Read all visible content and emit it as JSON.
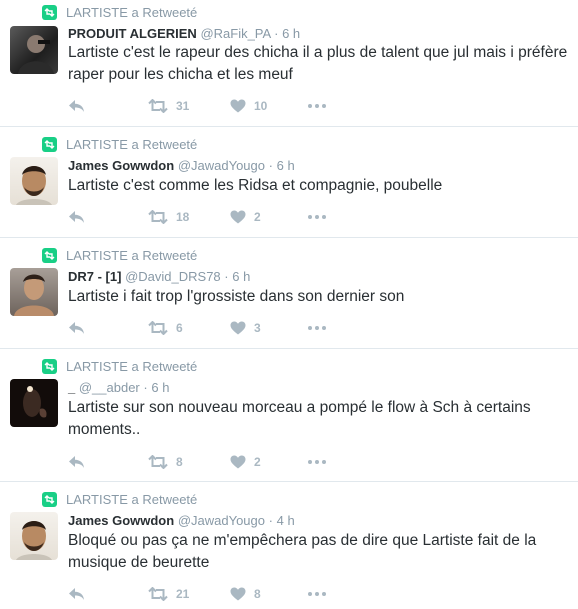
{
  "colors": {
    "retweet_green": "#19cf86",
    "muted_text": "#8899a6",
    "icon_gray": "#aab8c2",
    "divider": "#e1e8ed",
    "text": "#292f33"
  },
  "tweets": [
    {
      "context": "LARTISTE a Retweeté",
      "name": "PRODUIT ALGERIEN",
      "handle": "@RaFik_PA",
      "separator": "·",
      "time": "6 h",
      "text": "Lartiste c'est le rapeur des chicha il a plus de talent que jul mais i préfère raper pour les chicha et les meuf",
      "retweets": "31",
      "likes": "10",
      "avatar_icon": "user-avatar"
    },
    {
      "context": "LARTISTE a Retweeté",
      "name": "James Gowwdon",
      "handle": "@JawadYougo",
      "separator": "·",
      "time": "6 h",
      "text": "Lartiste c'est comme les Ridsa et compagnie, poubelle",
      "retweets": "18",
      "likes": "2",
      "avatar_icon": "user-avatar"
    },
    {
      "context": "LARTISTE a Retweeté",
      "name": "DR7 - [1]",
      "handle": "@David_DRS78",
      "separator": "·",
      "time": "6 h",
      "text": "Lartiste i fait trop l'grossiste dans son dernier son",
      "retweets": "6",
      "likes": "3",
      "avatar_icon": "user-avatar"
    },
    {
      "context": "LARTISTE a Retweeté",
      "name": "_",
      "handle": "@__abder",
      "separator": "·",
      "time": "6 h",
      "text": "Lartiste sur son nouveau morceau a pompé le flow à Sch à certains moments..",
      "retweets": "8",
      "likes": "2",
      "avatar_icon": "user-avatar"
    },
    {
      "context": "LARTISTE a Retweeté",
      "name": "James Gowwdon",
      "handle": "@JawadYougo",
      "separator": "·",
      "time": "4 h",
      "text": "Bloqué ou pas ça ne m'empêchera pas de dire que Lartiste fait de la musique de beurette",
      "retweets": "21",
      "likes": "8",
      "avatar_icon": "user-avatar"
    }
  ]
}
